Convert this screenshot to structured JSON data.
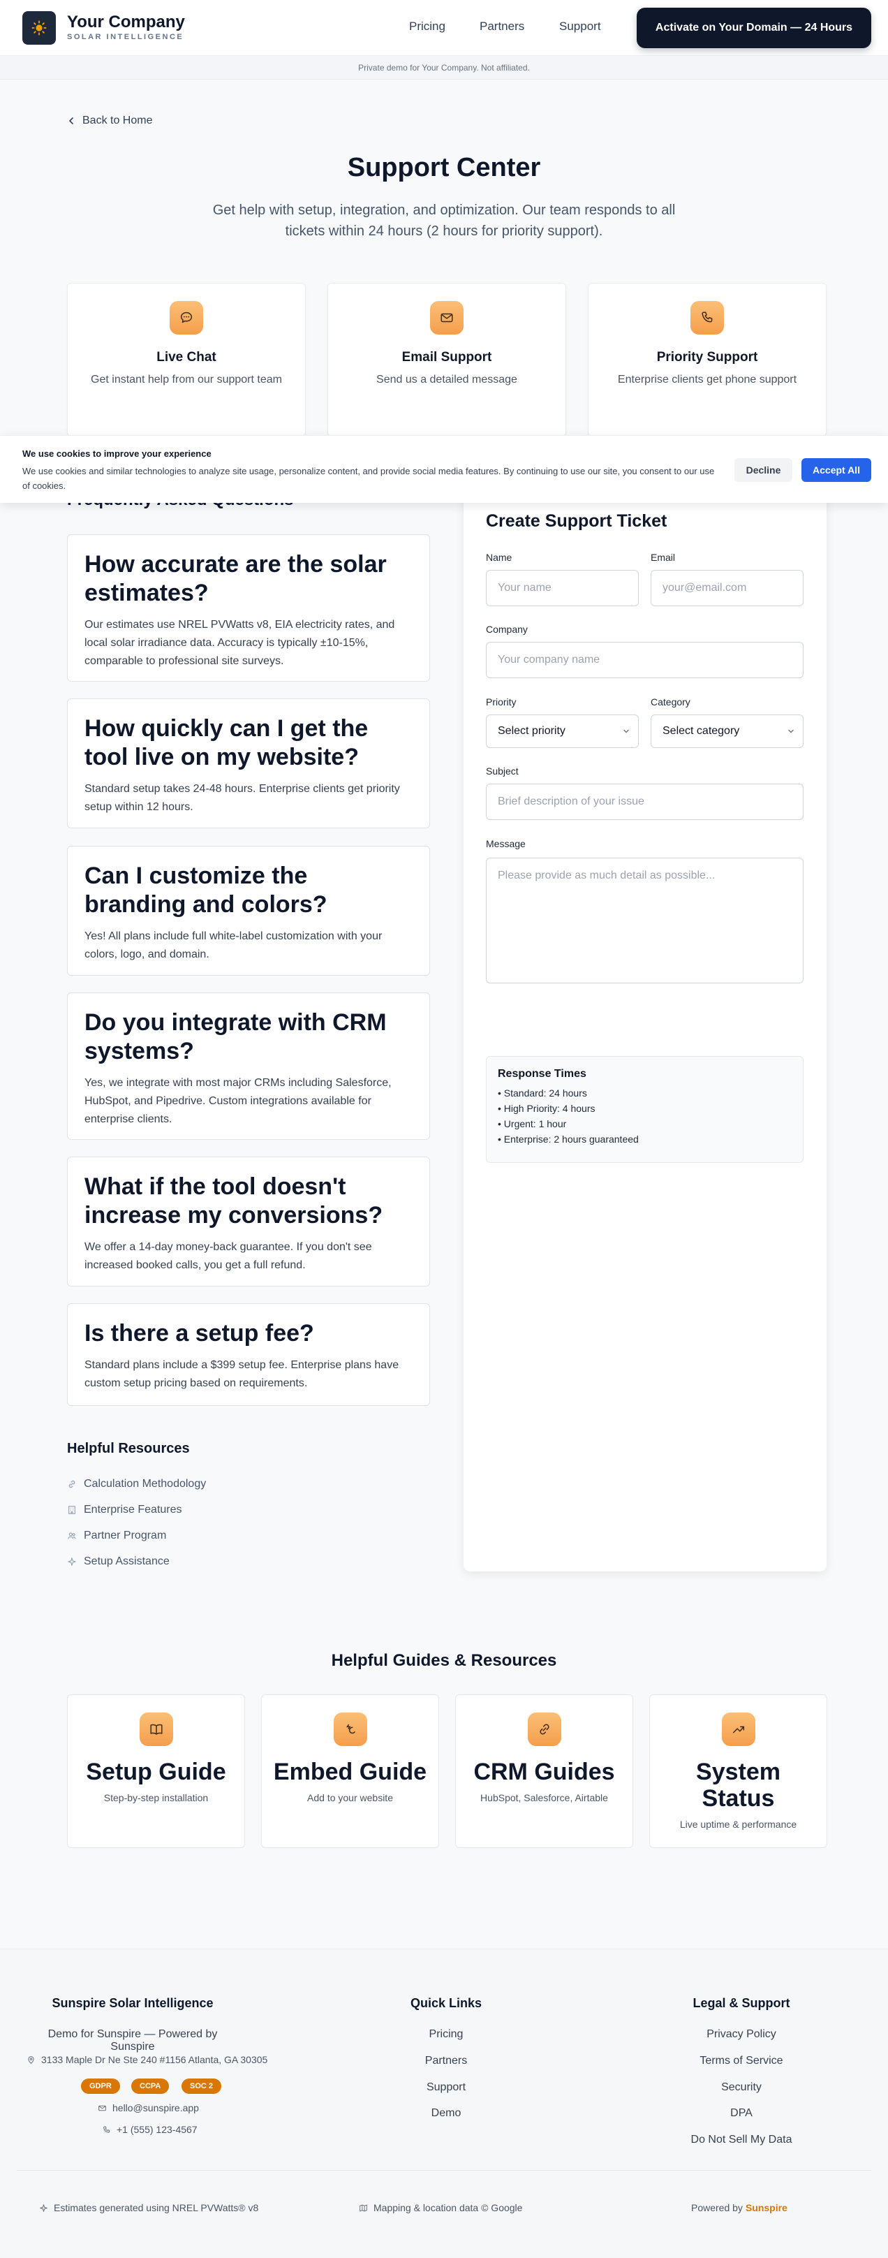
{
  "header": {
    "brand_name": "Your Company",
    "brand_sub": "SOLAR INTELLIGENCE",
    "nav": [
      "Pricing",
      "Partners",
      "Support"
    ],
    "cta": "Activate on Your Domain — 24 Hours",
    "demo_notice": "Private demo for Your Company. Not affiliated."
  },
  "hero": {
    "back": "Back to Home",
    "title": "Support Center",
    "subtitle": "Get help with setup, integration, and optimization. Our team responds to all tickets within 24 hours (2 hours for priority support)."
  },
  "channels": [
    {
      "title": "Live Chat",
      "desc": "Get instant help from our support team",
      "icon": "chat-icon"
    },
    {
      "title": "Email Support",
      "desc": "Send us a detailed message",
      "icon": "mail-icon"
    },
    {
      "title": "Priority Support",
      "desc": "Enterprise clients get phone support",
      "icon": "phone-icon"
    }
  ],
  "cookie": {
    "title": "We use cookies to improve your experience",
    "text": "We use cookies and similar technologies to analyze site usage, personalize content, and provide social media features. By continuing to use our site, you consent to our use of cookies.",
    "decline": "Decline",
    "accept": "Accept All"
  },
  "faq": {
    "heading": "Frequently Asked Questions",
    "items": [
      {
        "q": "How accurate are the solar estimates?",
        "a": "Our estimates use NREL PVWatts v8, EIA electricity rates, and local solar irradiance data. Accuracy is typically ±10-15%, comparable to professional site surveys."
      },
      {
        "q": "How quickly can I get the tool live on my website?",
        "a": "Standard setup takes 24-48 hours. Enterprise clients get priority setup within 12 hours."
      },
      {
        "q": "Can I customize the branding and colors?",
        "a": "Yes! All plans include full white-label customization with your colors, logo, and domain."
      },
      {
        "q": "Do you integrate with CRM systems?",
        "a": "Yes, we integrate with most major CRMs including Salesforce, HubSpot, and Pipedrive. Custom integrations available for enterprise clients."
      },
      {
        "q": "What if the tool doesn't increase my conversions?",
        "a": "We offer a 14-day money-back guarantee. If you don't see increased booked calls, you get a full refund."
      },
      {
        "q": "Is there a setup fee?",
        "a": "Standard plans include a $399 setup fee. Enterprise plans have custom setup pricing based on requirements."
      }
    ]
  },
  "resources": {
    "heading": "Helpful Resources",
    "items": [
      "Calculation Methodology",
      "Enterprise Features",
      "Partner Program",
      "Setup Assistance"
    ]
  },
  "ticket": {
    "title": "Create Support Ticket",
    "name_label": "Name",
    "name_placeholder": "Your name",
    "email_label": "Email",
    "email_placeholder": "your@email.com",
    "company_label": "Company",
    "company_placeholder": "Your company name",
    "priority_label": "Priority",
    "priority_value": "Select priority",
    "category_label": "Category",
    "category_value": "Select category",
    "subject_label": "Subject",
    "subject_placeholder": "Brief description of your issue",
    "message_label": "Message",
    "message_placeholder": "Please provide as much detail as possible...",
    "response": {
      "title": "Response Times",
      "lines": [
        "• Standard: 24 hours",
        "• High Priority: 4 hours",
        "• Urgent: 1 hour",
        "• Enterprise: 2 hours guaranteed"
      ]
    }
  },
  "guides": {
    "heading": "Helpful Guides & Resources",
    "items": [
      {
        "title": "Setup Guide",
        "desc": "Step-by-step installation"
      },
      {
        "title": "Embed Guide",
        "desc": "Add to your website"
      },
      {
        "title": "CRM Guides",
        "desc": "HubSpot, Salesforce, Airtable"
      },
      {
        "title": "System Status",
        "desc": "Live uptime & performance"
      }
    ]
  },
  "footer": {
    "company": "Sunspire Solar Intelligence",
    "demo_line": "Demo for Sunspire — Powered by Sunspire",
    "address": "3133 Maple Dr Ne Ste 240 #1156 Atlanta, GA 30305",
    "badges": [
      "GDPR",
      "CCPA",
      "SOC 2"
    ],
    "email": "hello@sunspire.app",
    "phone": "+1 (555) 123-4567",
    "quick_title": "Quick Links",
    "quick_links": [
      "Pricing",
      "Partners",
      "Support",
      "Demo"
    ],
    "legal_title": "Legal & Support",
    "legal_links": [
      "Privacy Policy",
      "Terms of Service",
      "Security",
      "DPA",
      "Do Not Sell My Data"
    ],
    "note_left": "Estimates generated using NREL PVWatts® v8",
    "note_mid": "Mapping & location data © Google",
    "powered": "Powered by",
    "powered_brand": "Sunspire"
  },
  "colors": {
    "accent_orange": "#f59e4b",
    "primary_dark": "#0f172a",
    "accept_blue": "#2563eb",
    "badge_orange": "#d97706"
  }
}
